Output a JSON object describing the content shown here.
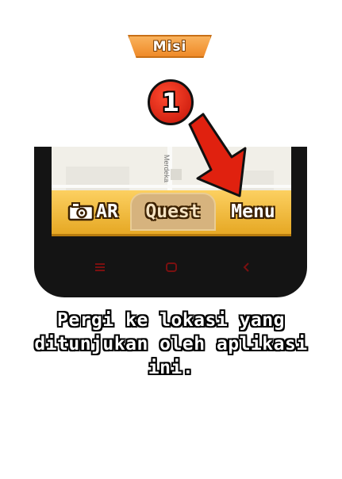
{
  "header_tab": {
    "label": "Misi"
  },
  "step_badge": {
    "number": "1"
  },
  "phone": {
    "map_street_label": "Merdeka",
    "tabs": [
      {
        "label": "AR",
        "icon": "camera-icon"
      },
      {
        "label": "Quest"
      },
      {
        "label": "Menu"
      }
    ],
    "nav_icons": [
      "menu-icon",
      "home-icon",
      "back-icon"
    ]
  },
  "instruction": {
    "text": "Pergi ke lokasi yang ditunjukan oleh aplikasi ini."
  },
  "colors": {
    "accent_orange": "#ef8a29",
    "tab_yellow": "#fcd061",
    "callout_red": "#e0210f",
    "nav_red": "#7a1010"
  }
}
